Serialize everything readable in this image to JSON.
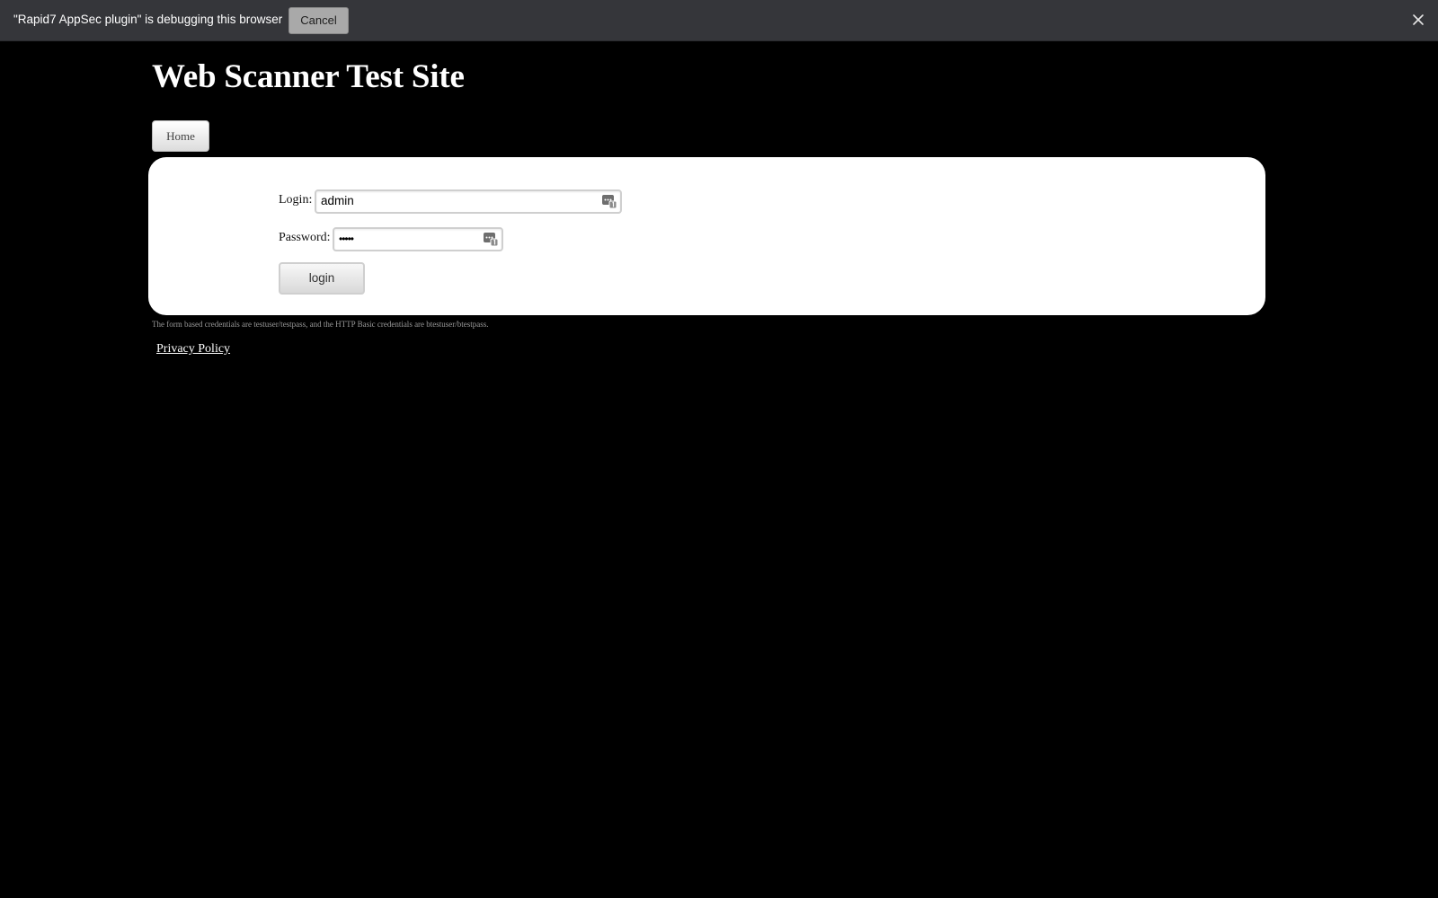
{
  "debug_banner": {
    "message": "\"Rapid7 AppSec plugin\" is debugging this browser",
    "cancel_label": "Cancel",
    "close_icon": "close-icon"
  },
  "page": {
    "title": "Web Scanner Test Site",
    "nav": {
      "home_label": "Home"
    },
    "form": {
      "login_label": "Login:",
      "login_value": "admin",
      "password_label": "Password:",
      "password_value": "•••••",
      "submit_label": "login",
      "autofill_icon": "password-manager-icon"
    },
    "credentials_note": "The form based credentials are testuser/testpass, and the HTTP Basic credentials are btestuser/btestpass.",
    "privacy_link": "Privacy Policy"
  },
  "colors": {
    "page_background": "#000000",
    "banner_background": "#35363a",
    "panel_background": "#ffffff"
  }
}
